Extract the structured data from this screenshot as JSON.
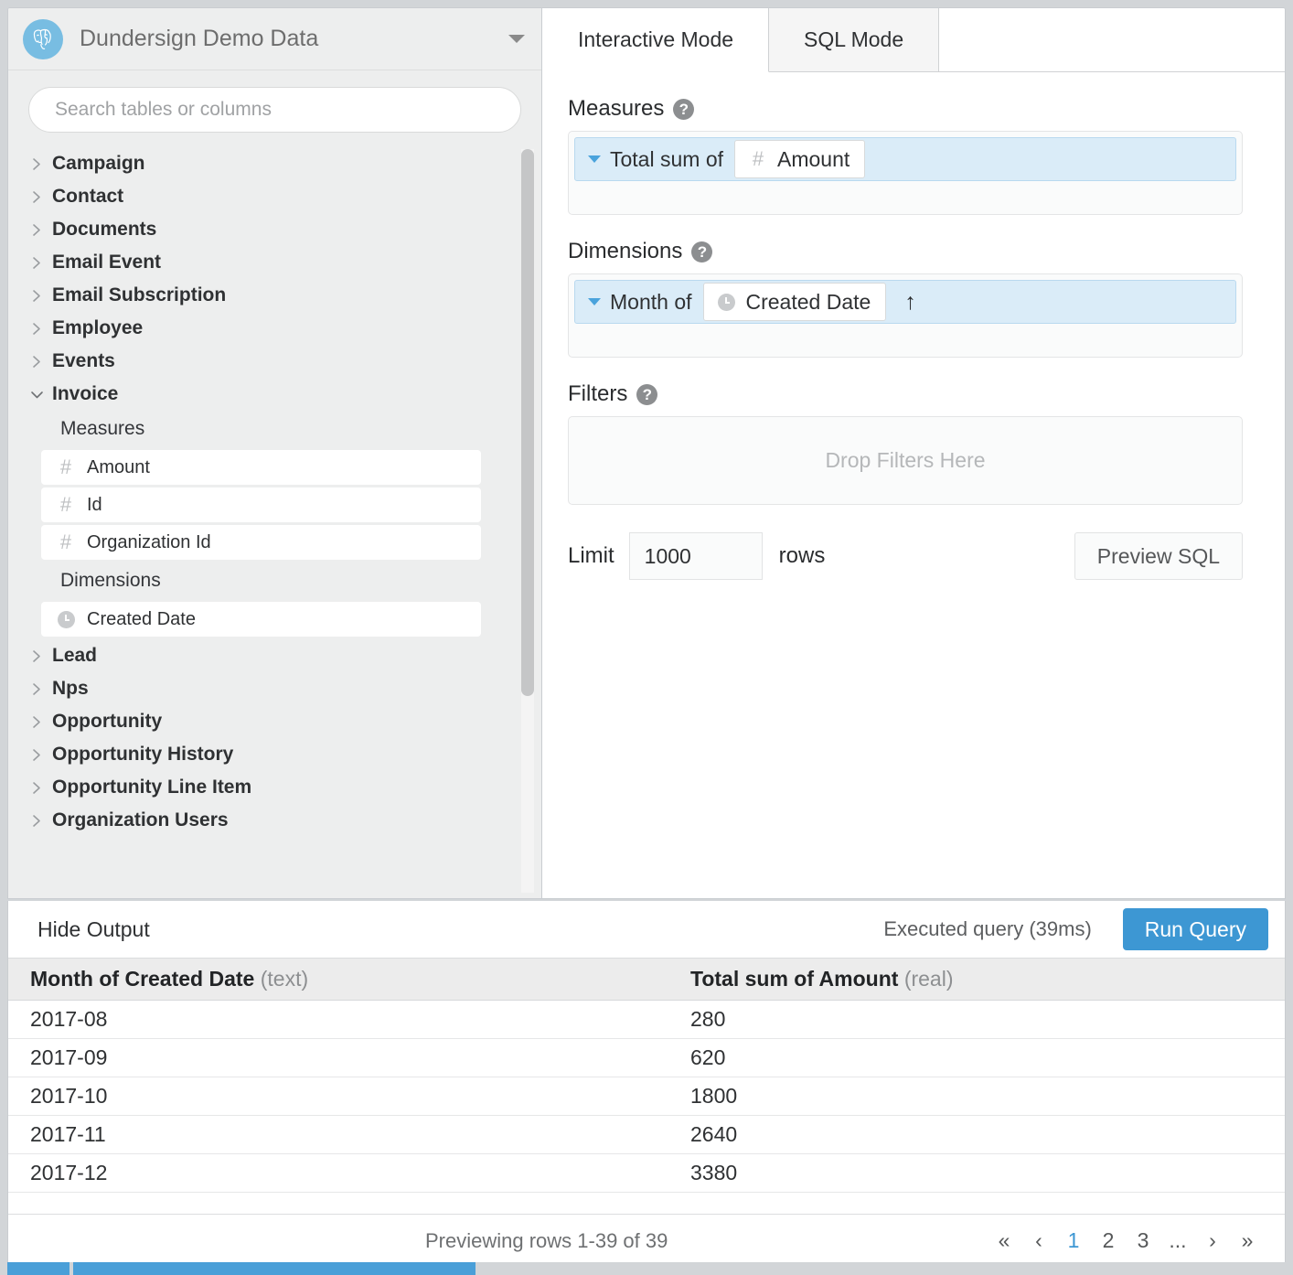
{
  "sidebar": {
    "database_name": "Dundersign Demo Data",
    "database_icon": "postgresql-elephant-icon",
    "dropdown_icon": "chevron-down-icon",
    "search": {
      "placeholder": "Search tables or columns"
    },
    "tables": [
      {
        "label": "Campaign",
        "expanded": false
      },
      {
        "label": "Contact",
        "expanded": false
      },
      {
        "label": "Documents",
        "expanded": false
      },
      {
        "label": "Email Event",
        "expanded": false
      },
      {
        "label": "Email Subscription",
        "expanded": false
      },
      {
        "label": "Employee",
        "expanded": false
      },
      {
        "label": "Events",
        "expanded": false
      },
      {
        "label": "Invoice",
        "expanded": true
      },
      {
        "label": "Lead",
        "expanded": false
      },
      {
        "label": "Nps",
        "expanded": false
      },
      {
        "label": "Opportunity",
        "expanded": false
      },
      {
        "label": "Opportunity History",
        "expanded": false
      },
      {
        "label": "Opportunity Line Item",
        "expanded": false
      },
      {
        "label": "Organization Users",
        "expanded": false
      }
    ],
    "invoice_measures_header": "Measures",
    "invoice_measures": [
      {
        "label": "Amount",
        "icon": "hash-icon"
      },
      {
        "label": "Id",
        "icon": "hash-icon"
      },
      {
        "label": "Organization Id",
        "icon": "hash-icon"
      }
    ],
    "invoice_dimensions_header": "Dimensions",
    "invoice_dimensions": [
      {
        "label": "Created Date",
        "icon": "clock-icon"
      }
    ]
  },
  "tabs": [
    {
      "label": "Interactive Mode",
      "active": true
    },
    {
      "label": "SQL Mode",
      "active": false
    }
  ],
  "builder": {
    "measures_label": "Measures",
    "measures_pill": {
      "aggregation": "Total sum of",
      "field": "Amount",
      "field_icon": "hash-icon"
    },
    "dimensions_label": "Dimensions",
    "dimensions_pill": {
      "grouping": "Month of",
      "field": "Created Date",
      "field_icon": "clock-icon",
      "sort_icon": "↑"
    },
    "filters_label": "Filters",
    "filters_placeholder": "Drop Filters Here",
    "limit_label": "Limit",
    "limit_value": "1000",
    "rows_label": "rows",
    "preview_sql_label": "Preview SQL",
    "help_icon": "question-mark-icon"
  },
  "output": {
    "hide_output_label": "Hide Output",
    "executed_text": "Executed query (39ms)",
    "run_query_label": "Run Query",
    "columns": [
      {
        "name": "Month of Created Date",
        "type": "(text)"
      },
      {
        "name": "Total sum of Amount",
        "type": "(real)"
      }
    ],
    "rows": [
      {
        "month": "2017-08",
        "total": "280"
      },
      {
        "month": "2017-09",
        "total": "620"
      },
      {
        "month": "2017-10",
        "total": "1800"
      },
      {
        "month": "2017-11",
        "total": "2640"
      },
      {
        "month": "2017-12",
        "total": "3380"
      }
    ],
    "preview_text": "Previewing rows 1-39 of 39",
    "pagination": [
      {
        "label": "«",
        "name": "first-page",
        "active": false
      },
      {
        "label": "‹",
        "name": "prev-page",
        "active": false
      },
      {
        "label": "1",
        "name": "page-1",
        "active": true
      },
      {
        "label": "2",
        "name": "page-2",
        "active": false
      },
      {
        "label": "3",
        "name": "page-3",
        "active": false
      },
      {
        "label": "...",
        "name": "page-ellipsis",
        "active": false
      },
      {
        "label": "›",
        "name": "next-page",
        "active": false
      },
      {
        "label": "»",
        "name": "last-page",
        "active": false
      }
    ]
  },
  "colors": {
    "accent_blue": "#3d97d3",
    "pill_blue": "#daecf8",
    "pill_border": "#b9d9ef",
    "sidebar_bg": "#edeeee",
    "app_bg": "#d2d5d8"
  }
}
